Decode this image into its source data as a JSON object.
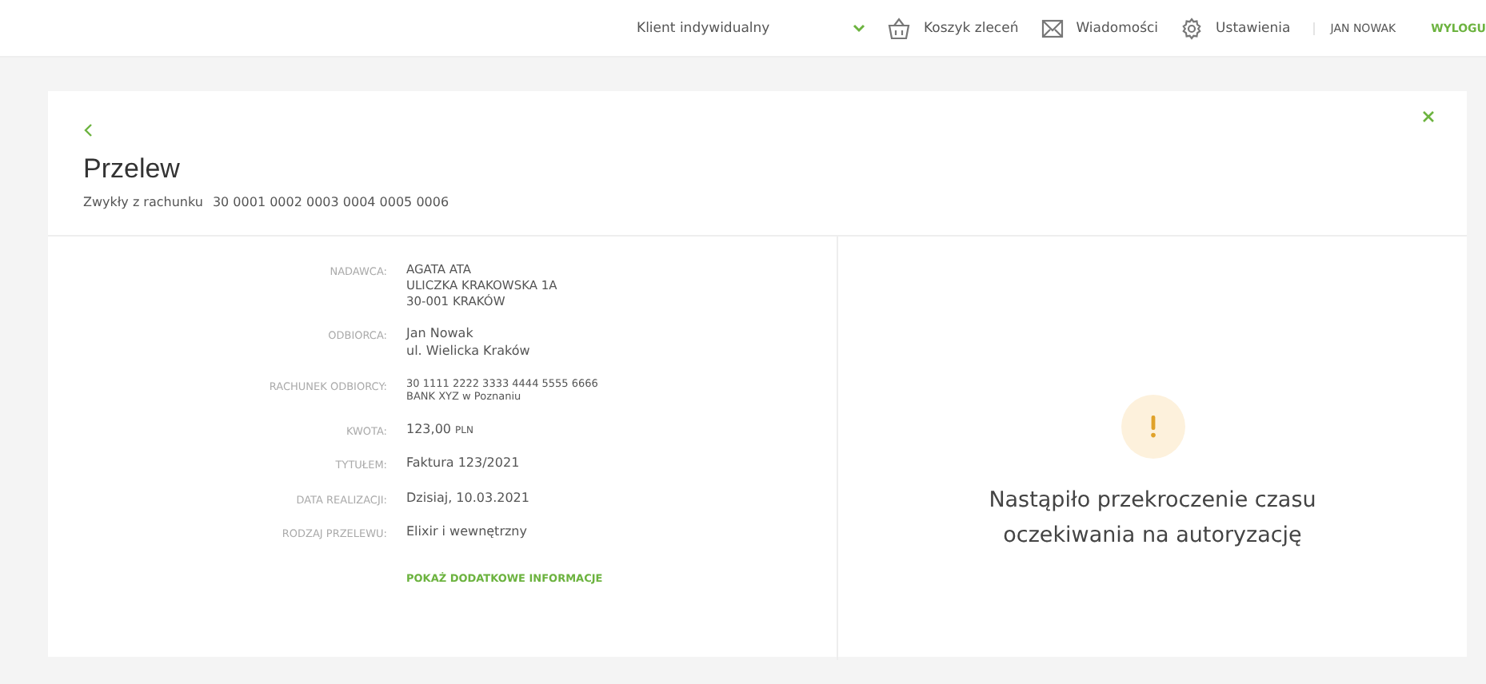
{
  "topbar": {
    "client_select": {
      "value": "Klient indywidualny"
    },
    "links": [
      {
        "kind": "basket",
        "label": "Koszyk zleceń"
      },
      {
        "kind": "mail",
        "label": "Wiadomości"
      },
      {
        "kind": "gear",
        "label": "Ustawienia"
      }
    ],
    "user": "JAN NOWAK",
    "logout": "WYLOGU"
  },
  "card": {
    "title": "Przelew",
    "subtitle_label": "Zwykły z rachunku",
    "account": "30 0001 0002 0003 0004 0005 0006",
    "details": [
      {
        "label": "NADAWCA:",
        "kind": "text",
        "lines": [
          "AGATA ATA",
          "ULICZKA KRAKOWSKA 1A",
          "30-001 KRAKÓW"
        ]
      },
      {
        "label": "ODBIORCA:",
        "kind": "text",
        "lines": [
          "Jan Nowak",
          "ul. Wielicka Kraków"
        ]
      },
      {
        "label": "RACHUNEK ODBIORCY:",
        "kind": "small",
        "lines": [
          "30 1111 2222 3333 4444 5555 6666",
          "BANK XYZ w Poznaniu"
        ]
      },
      {
        "label": "KWOTA:",
        "kind": "amount",
        "lines": [
          "123,00"
        ],
        "unit": "PLN"
      },
      {
        "label": "TYTUŁEM:",
        "kind": "text",
        "lines": [
          "Faktura 123/2021"
        ]
      },
      {
        "label": "DATA REALIZACJI:",
        "kind": "text",
        "lines": [
          "Dzisiaj, 10.03.2021"
        ]
      },
      {
        "label": "RODZAJ PRZELEWU:",
        "kind": "text",
        "lines": [
          "Elixir i wewnętrzny"
        ]
      }
    ],
    "more_link": "POKAŻ DODATKOWE INFORMACJE",
    "message": "Nastąpiło przekroczenie czasu oczekiwania na autoryzację"
  }
}
